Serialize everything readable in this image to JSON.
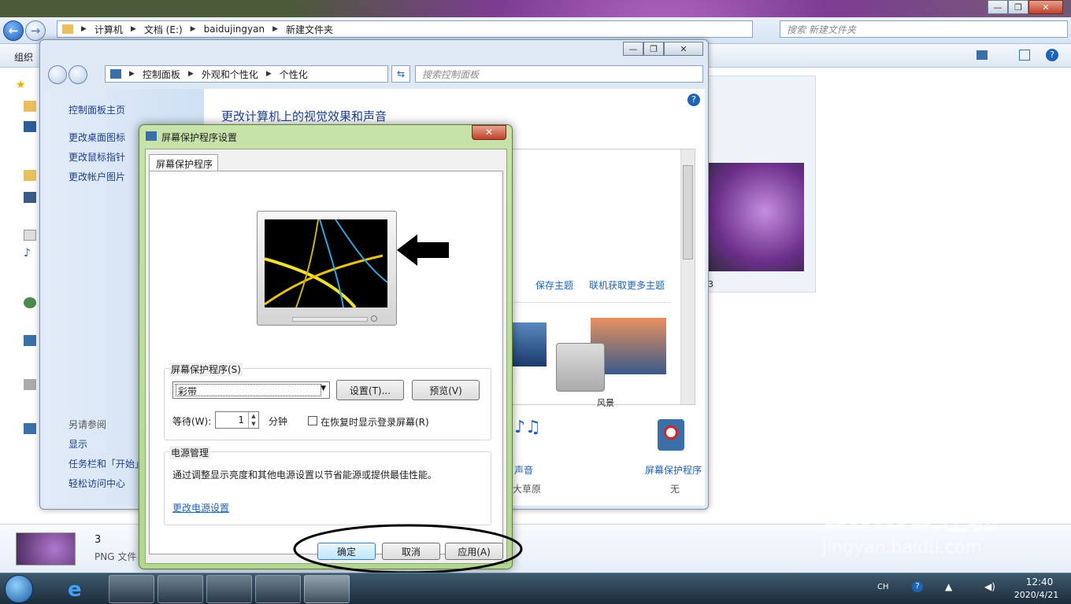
{
  "explorer": {
    "breadcrumb": [
      "计算机",
      "文档 (E:)",
      "baidujingyan",
      "新建文件夹"
    ],
    "search_placeholder": "搜索 新建文件夹",
    "toolbar_organize": "组织",
    "file_name": "3",
    "file_type": "PNG 文件",
    "thumb_label": "3"
  },
  "control_panel": {
    "breadcrumb": [
      "控制面板",
      "外观和个性化",
      "个性化"
    ],
    "search_placeholder": "搜索控制面板",
    "left_links": [
      "控制面板主页",
      "更改桌面图标",
      "更改鼠标指针",
      "更改帐户图片"
    ],
    "see_also_title": "另请参阅",
    "see_also_links": [
      "显示",
      "任务栏和「开始」",
      "轻松访问中心"
    ],
    "heading": "更改计算机上的视觉效果和声音",
    "save_theme": "保存主题",
    "get_more_themes": "联机获取更多主题",
    "theme_partial_label": "风景",
    "sound_label": "声音",
    "sound_value": "大草原",
    "screensaver_label": "屏幕保护程序",
    "screensaver_value": "无"
  },
  "dialog": {
    "title": "屏幕保护程序设置",
    "tab": "屏幕保护程序",
    "group_screensaver": "屏幕保护程序(S)",
    "selected_saver": "彩带",
    "settings_button": "设置(T)...",
    "preview_button": "预览(V)",
    "wait_label": "等待(W):",
    "wait_value": "1",
    "minutes": "分钟",
    "resume_checkbox": "在恢复时显示登录屏幕(R)",
    "group_power": "电源管理",
    "power_text": "通过调整显示亮度和其他电源设置以节省能源或提供最佳性能。",
    "power_link": "更改电源设置",
    "ok": "确定",
    "cancel": "取消",
    "apply": "应用(A)"
  },
  "taskbar": {
    "time": "12:40",
    "date": "2020/4/21",
    "lang": "CH"
  },
  "watermark": {
    "logo": "Baidu经验",
    "url": "jingyan.baidu.com"
  }
}
